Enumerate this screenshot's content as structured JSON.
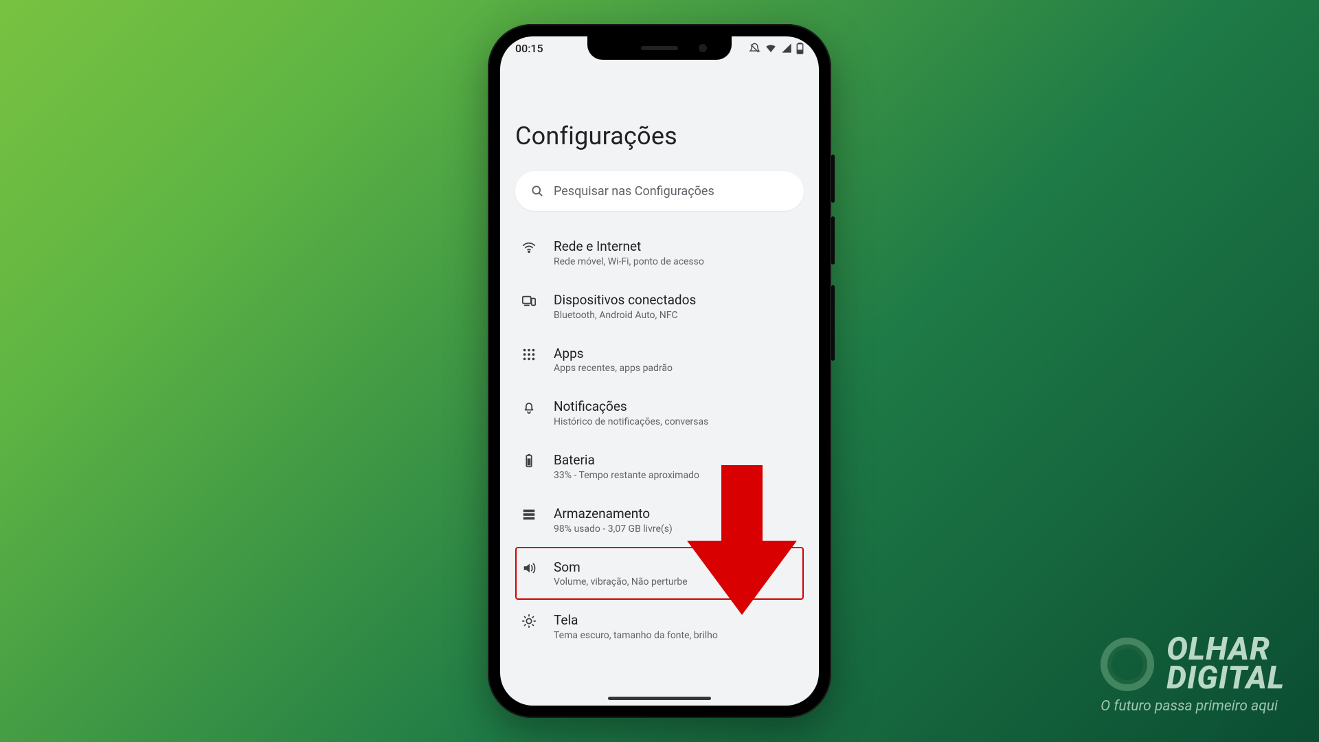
{
  "statusbar": {
    "time": "00:15"
  },
  "page": {
    "title": "Configurações"
  },
  "search": {
    "placeholder": "Pesquisar nas Configurações"
  },
  "settings": [
    {
      "id": "network",
      "icon": "wifi",
      "title": "Rede e Internet",
      "sub": "Rede móvel, Wi-Fi, ponto de acesso"
    },
    {
      "id": "devices",
      "icon": "devices",
      "title": "Dispositivos conectados",
      "sub": "Bluetooth, Android Auto, NFC"
    },
    {
      "id": "apps",
      "icon": "apps",
      "title": "Apps",
      "sub": "Apps recentes, apps padrão"
    },
    {
      "id": "notif",
      "icon": "bell",
      "title": "Notificações",
      "sub": "Histórico de notificações, conversas"
    },
    {
      "id": "battery",
      "icon": "battery",
      "title": "Bateria",
      "sub": "33% - Tempo restante aproximado"
    },
    {
      "id": "storage",
      "icon": "storage",
      "title": "Armazenamento",
      "sub": "98% usado - 3,07 GB livre(s)"
    },
    {
      "id": "sound",
      "icon": "sound",
      "title": "Som",
      "sub": "Volume, vibração, Não perturbe",
      "highlight": true
    },
    {
      "id": "display",
      "icon": "display",
      "title": "Tela",
      "sub": "Tema escuro, tamanho da fonte, brilho"
    }
  ],
  "annotation": {
    "arrow_color": "#d80000"
  },
  "watermark": {
    "line1": "OLHAR",
    "line2": "DIGITAL",
    "tagline": "O futuro passa primeiro aqui"
  }
}
